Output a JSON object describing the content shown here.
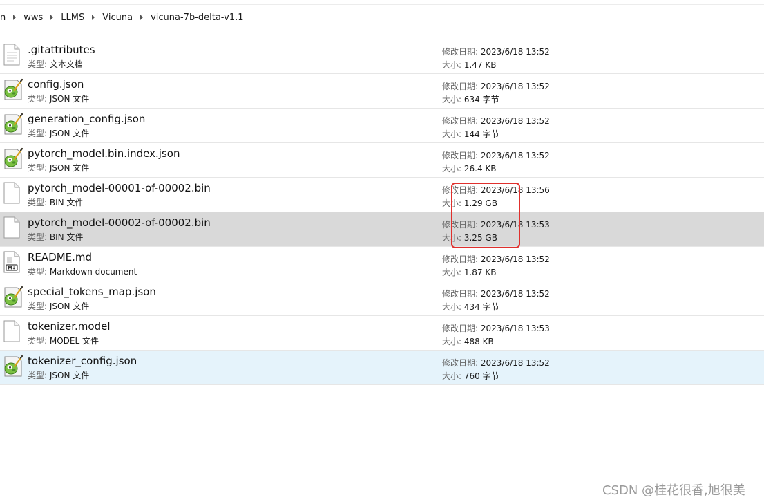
{
  "breadcrumb": [
    "n",
    "wws",
    "LLMS",
    "Vicuna",
    "vicuna-7b-delta-v1.1"
  ],
  "labels": {
    "type_prefix": "类型: ",
    "date_prefix": "修改日期: ",
    "size_prefix": "大小: "
  },
  "files": [
    {
      "name": ".gitattributes",
      "type": "文本文档",
      "date": "2023/6/18 13:52",
      "size": "1.47 KB",
      "icon": "text-document-icon"
    },
    {
      "name": "config.json",
      "type": "JSON 文件",
      "date": "2023/6/18 13:52",
      "size": "634 字节",
      "icon": "json-notepadpp-icon"
    },
    {
      "name": "generation_config.json",
      "type": "JSON 文件",
      "date": "2023/6/18 13:52",
      "size": "144 字节",
      "icon": "json-notepadpp-icon"
    },
    {
      "name": "pytorch_model.bin.index.json",
      "type": "JSON 文件",
      "date": "2023/6/18 13:52",
      "size": "26.4 KB",
      "icon": "json-notepadpp-icon"
    },
    {
      "name": "pytorch_model-00001-of-00002.bin",
      "type": "BIN 文件",
      "date": "2023/6/18 13:56",
      "size": "1.29 GB",
      "icon": "blank-file-icon"
    },
    {
      "name": "pytorch_model-00002-of-00002.bin",
      "type": "BIN 文件",
      "date": "2023/6/18 13:53",
      "size": "3.25 GB",
      "icon": "blank-file-icon",
      "state": "selected"
    },
    {
      "name": "README.md",
      "type": "Markdown document",
      "date": "2023/6/18 13:52",
      "size": "1.87 KB",
      "icon": "markdown-file-icon"
    },
    {
      "name": "special_tokens_map.json",
      "type": "JSON 文件",
      "date": "2023/6/18 13:52",
      "size": "434 字节",
      "icon": "json-notepadpp-icon"
    },
    {
      "name": "tokenizer.model",
      "type": "MODEL 文件",
      "date": "2023/6/18 13:53",
      "size": "488 KB",
      "icon": "blank-file-icon"
    },
    {
      "name": "tokenizer_config.json",
      "type": "JSON 文件",
      "date": "2023/6/18 13:52",
      "size": "760 字节",
      "icon": "json-notepadpp-icon",
      "state": "hovered"
    }
  ],
  "colors": {
    "selected_row": "#d9d9d9",
    "hovered_row": "#e5f3fb",
    "annotation": "#e0302d",
    "watermark": "#9a9a9a"
  },
  "watermark": "CSDN @桂花很香,旭很美"
}
